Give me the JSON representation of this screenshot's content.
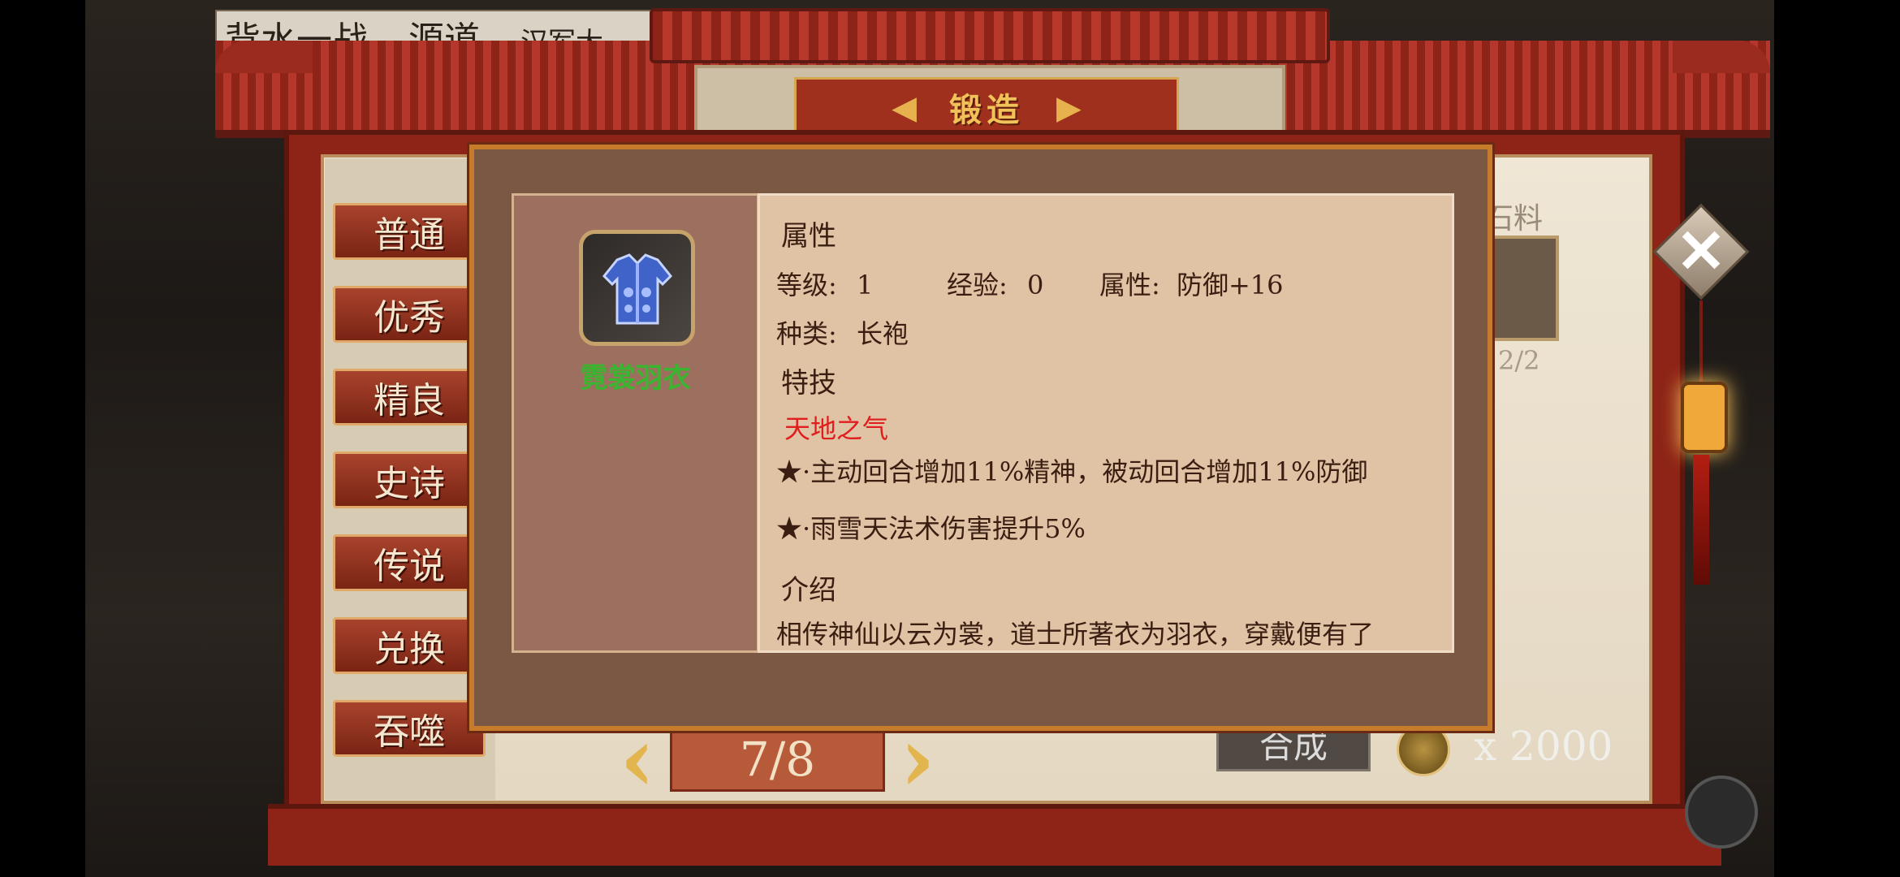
{
  "scene": {
    "top_sign_text_1": "背水一战",
    "top_sign_text_2": "源道",
    "top_sign_text_3": "汉军大"
  },
  "title": "锻造",
  "categories": [
    "普通",
    "优秀",
    "精良",
    "史诗",
    "传说",
    "兑换",
    "吞噬"
  ],
  "behind": {
    "material_label": "石料",
    "material_count": "2/2",
    "synth_label": "合成",
    "cost": "x 2000"
  },
  "pager": {
    "page_text": "7/8"
  },
  "item": {
    "name": "霓裳羽衣",
    "name_color": "#39b52f",
    "attributes_heading": "属性",
    "level_label": "等级:",
    "level_value": "1",
    "exp_label": "经验:",
    "exp_value": "0",
    "attr_label": "属性:",
    "attr_value": "防御+16",
    "type_label": "种类:",
    "type_value": "长袍",
    "skills_heading": "特技",
    "skill_name": "天地之气",
    "skill_effects": [
      "★·主动回合增加11%精神，被动回合增加11%防御",
      "★·雨雪天法术伤害提升5%"
    ],
    "intro_heading": "介绍",
    "intro_text": "相传神仙以云为裳，道士所著衣为羽衣，穿戴便有了"
  },
  "icons": [
    "close-icon",
    "chevron-left-icon",
    "chevron-right-icon",
    "coin-icon",
    "robe-icon",
    "menu-grid-icon"
  ]
}
